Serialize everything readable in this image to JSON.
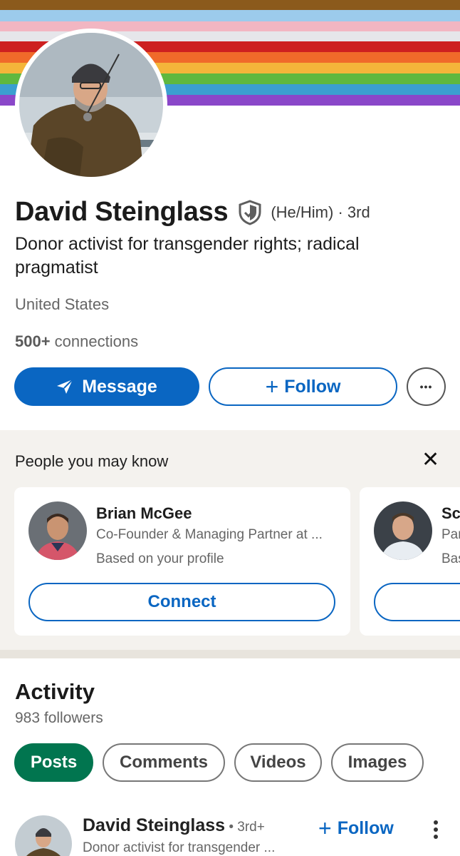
{
  "banner": {
    "stripes": [
      "#8b5a1c",
      "#9ccbec",
      "#f2b6c2",
      "#e6e6ea",
      "#f7bcc8",
      "#b4d4ee",
      "#cd2020",
      "#f06a2a",
      "#f4b53a",
      "#5fb83f",
      "#3b9fd0",
      "#8a47c9"
    ]
  },
  "profile": {
    "name": "David Steinglass",
    "pronouns": "(He/Him)",
    "degree": "· 3rd",
    "headline": "Donor activist for transgender rights; radical pragmatist",
    "location": "United States",
    "connections_count": "500+",
    "connections_label": " connections",
    "verified_icon": "shield-check-icon"
  },
  "actions": {
    "message_label": "Message",
    "follow_label": "Follow",
    "more_label": "•••"
  },
  "pymk": {
    "title": "People you may know",
    "close": "✕",
    "people": [
      {
        "name": "Brian McGee",
        "title": "Co-Founder & Managing Partner at ...",
        "reason": "Based on your profile",
        "button": "Connect"
      },
      {
        "name": "Sc",
        "title": "Par",
        "reason": "Bas",
        "button": ""
      }
    ]
  },
  "activity": {
    "title": "Activity",
    "followers": "983 followers",
    "tabs": [
      "Posts",
      "Comments",
      "Videos",
      "Images"
    ],
    "active_tab": "Posts"
  },
  "post": {
    "author": "David Steinglass",
    "degree": " • 3rd+",
    "subtitle": "Donor activist for transgender ...",
    "follow_label": "Follow"
  },
  "colors": {
    "primary": "#0a66c2",
    "active_tab": "#01754f",
    "section_bg": "#f4f2ee"
  }
}
